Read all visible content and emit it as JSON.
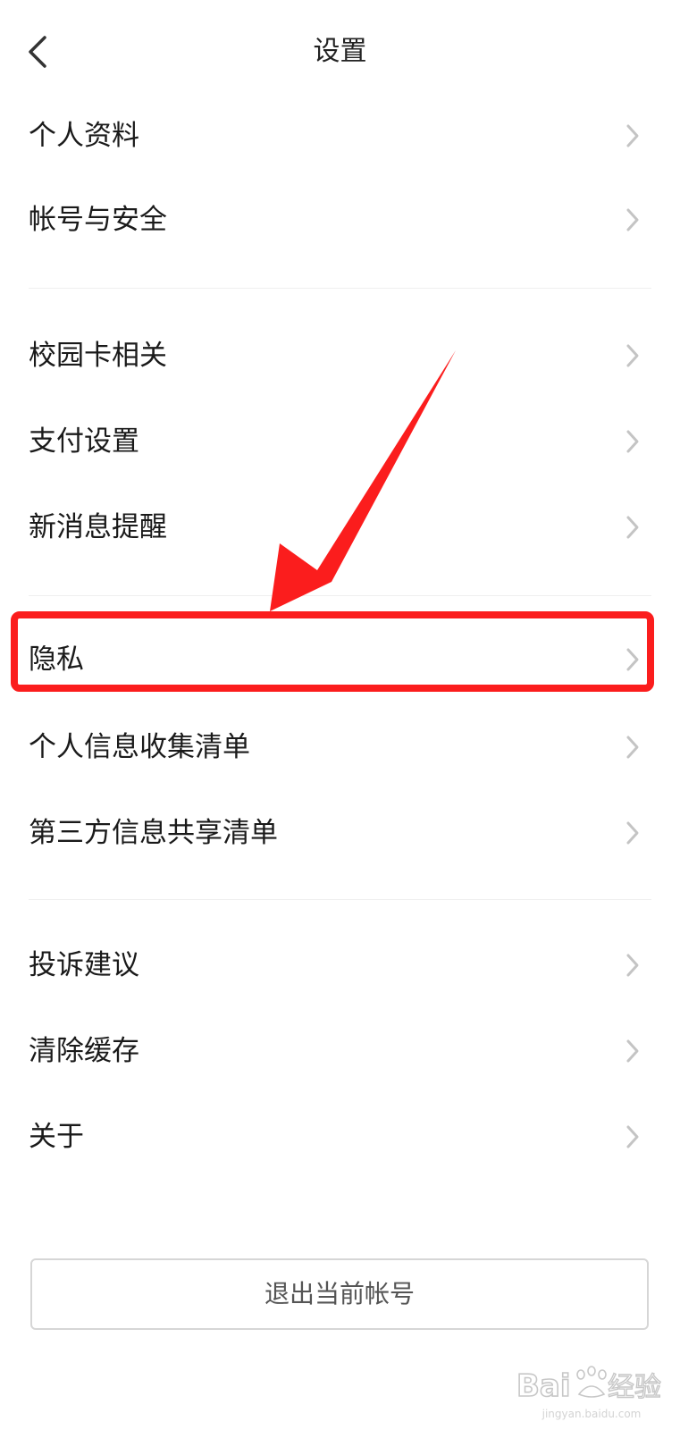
{
  "header": {
    "title": "设置",
    "back_icon": "chevron-left-icon"
  },
  "groups": [
    {
      "items": [
        {
          "label": "个人资料"
        },
        {
          "label": "帐号与安全"
        }
      ]
    },
    {
      "items": [
        {
          "label": "校园卡相关"
        },
        {
          "label": "支付设置"
        },
        {
          "label": "新消息提醒"
        }
      ]
    },
    {
      "items": [
        {
          "label": "隐私"
        },
        {
          "label": "个人信息收集清单"
        },
        {
          "label": "第三方信息共享清单"
        }
      ]
    },
    {
      "items": [
        {
          "label": "投诉建议"
        },
        {
          "label": "清除缓存"
        },
        {
          "label": "关于"
        }
      ]
    }
  ],
  "item_chevron_icon": "chevron-right-icon",
  "logout": {
    "label": "退出当前帐号"
  },
  "annotation": {
    "highlighted_item": "隐私",
    "highlight_color": "#fb1d1d",
    "arrow_icon": "red-arrow-icon"
  },
  "watermark": {
    "brand": "Baidu经验",
    "site": "jingyan.baidu.com"
  }
}
